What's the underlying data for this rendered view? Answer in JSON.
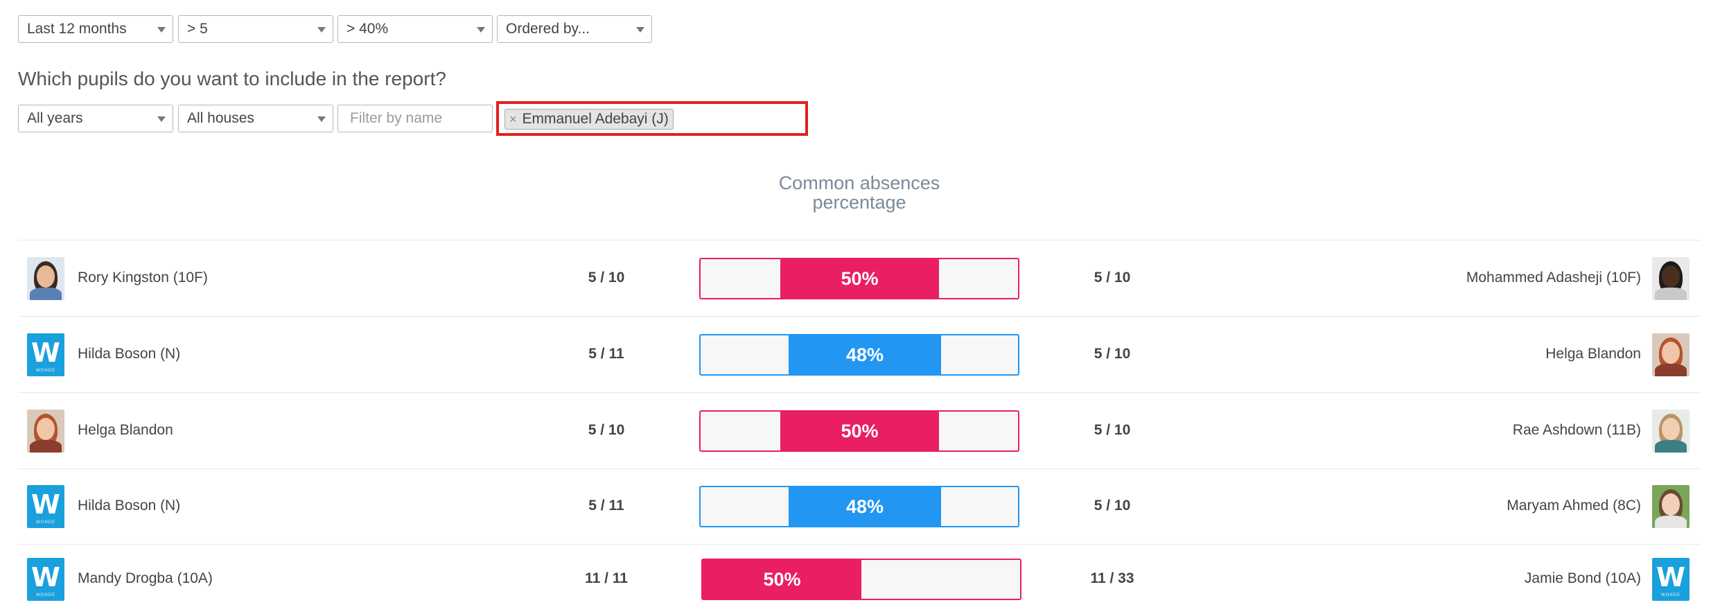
{
  "filters": {
    "period": "Last 12 months",
    "minimum": "> 5",
    "percentage": "> 40%",
    "order": "Ordered by..."
  },
  "question": "Which pupils do you want to include in the report?",
  "pupil_filters": {
    "years": "All years",
    "houses": "All houses",
    "name_placeholder": "Filter by name",
    "selected_tag": "Emmanuel Adebayi (J)",
    "tag_remove": "×"
  },
  "column_header": {
    "line1": "Common absences",
    "line2": "percentage"
  },
  "colors": {
    "pink": "#e91e63",
    "blue": "#2196f3",
    "highlight": "#e0201f"
  },
  "rows": [
    {
      "left_name": "Rory Kingston (10F)",
      "left_avatar": "boy-photo",
      "left_score": "5 / 10",
      "percent": "50%",
      "percent_value": 0.5,
      "color": "pink",
      "right_score": "5 / 10",
      "right_name": "Mohammed Adasheji (10F)",
      "right_avatar": "boy-dark-photo"
    },
    {
      "left_name": "Hilda Boson (N)",
      "left_avatar": "w-logo",
      "left_score": "5 / 11",
      "percent": "48%",
      "percent_value": 0.48,
      "color": "blue",
      "right_score": "5 / 10",
      "right_name": "Helga Blandon",
      "right_avatar": "girl-red-photo"
    },
    {
      "left_name": "Helga Blandon",
      "left_avatar": "girl-red-photo",
      "left_score": "5 / 10",
      "percent": "50%",
      "percent_value": 0.5,
      "color": "pink",
      "right_score": "5 / 10",
      "right_name": "Rae Ashdown (11B)",
      "right_avatar": "girl-blonde-photo"
    },
    {
      "left_name": "Hilda Boson (N)",
      "left_avatar": "w-logo",
      "left_score": "5 / 11",
      "percent": "48%",
      "percent_value": 0.48,
      "color": "blue",
      "right_score": "5 / 10",
      "right_name": "Maryam Ahmed (8C)",
      "right_avatar": "girl-garden-photo"
    },
    {
      "left_name": "Mandy Drogba (10A)",
      "left_avatar": "w-logo",
      "left_score": "11 / 11",
      "percent": "50%",
      "percent_value": 0.5,
      "color": "pink",
      "right_score": "11 / 33",
      "right_name": "Jamie Bond (10A)",
      "right_avatar": "w-logo"
    }
  ],
  "logo_text": {
    "letter": "W",
    "small": "WONDE"
  }
}
